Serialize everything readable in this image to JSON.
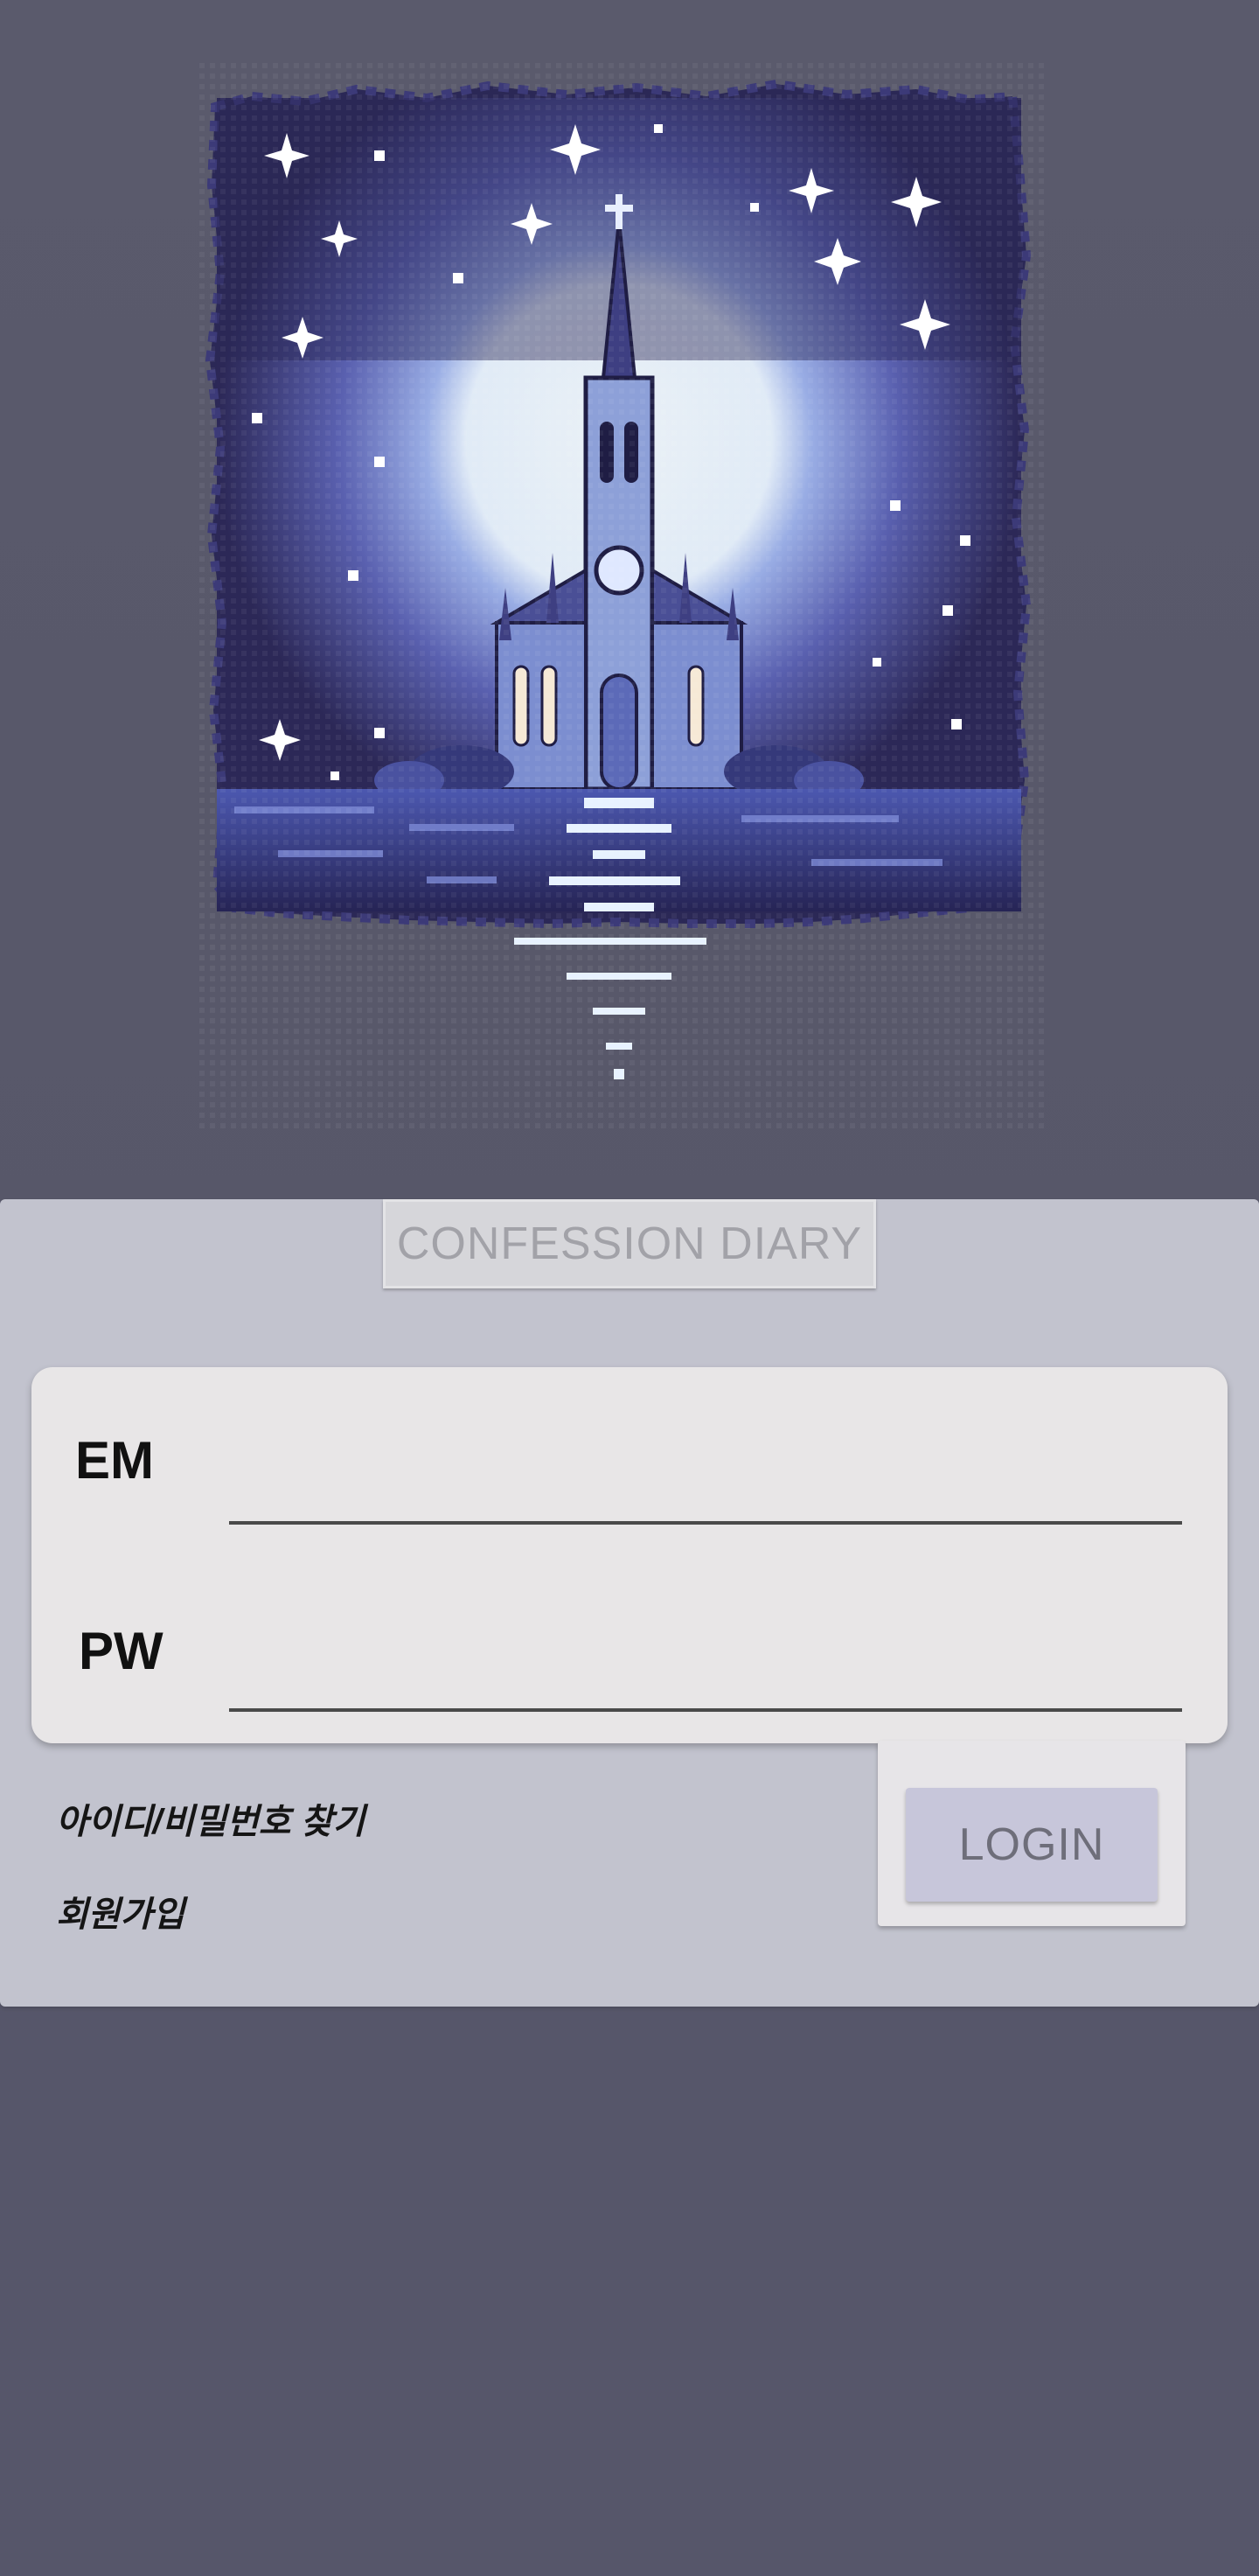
{
  "app": {
    "title": "CONFESSION DIARY"
  },
  "form": {
    "email_label": "EM",
    "email_value": "",
    "password_label": "PW",
    "password_value": ""
  },
  "links": {
    "find_account": "아이디/비밀번호 찾기",
    "signup": "회원가입"
  },
  "actions": {
    "login_label": "LOGIN"
  },
  "colors": {
    "background": "#595a6b",
    "panel": "#c2c3ce",
    "card": "#e8e6e7",
    "login_button": "#c7c6da",
    "title_text": "#a2a2a8"
  },
  "artwork": {
    "icon": "pixel-cathedral-night-illustration"
  }
}
